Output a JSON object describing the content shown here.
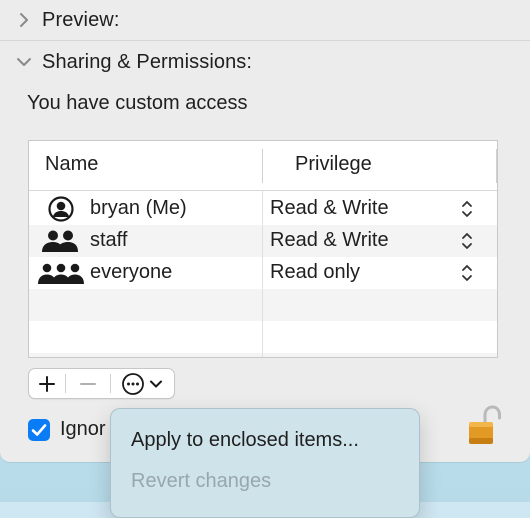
{
  "sections": {
    "preview": {
      "title": "Preview:",
      "expanded": false
    },
    "sharing": {
      "title": "Sharing & Permissions:",
      "expanded": true
    }
  },
  "access_text": "You have custom access",
  "table": {
    "columns": [
      "Name",
      "Privilege"
    ],
    "rows": [
      {
        "name": "bryan (Me)",
        "privilege": "Read & Write",
        "icon": "single-user-icon"
      },
      {
        "name": "staff",
        "privilege": "Read & Write",
        "icon": "group-icon"
      },
      {
        "name": "everyone",
        "privilege": "Read only",
        "icon": "everyone-icon"
      }
    ]
  },
  "toolbar": {
    "add": "+",
    "remove": "−"
  },
  "checkbox": {
    "label": "Ignor",
    "checked": true
  },
  "menu": {
    "items": [
      {
        "label": "Apply to enclosed items...",
        "enabled": true
      },
      {
        "label": "Revert changes",
        "enabled": false
      }
    ]
  },
  "colors": {
    "accent": "#0a7cf5",
    "lock": "#e39a24"
  }
}
